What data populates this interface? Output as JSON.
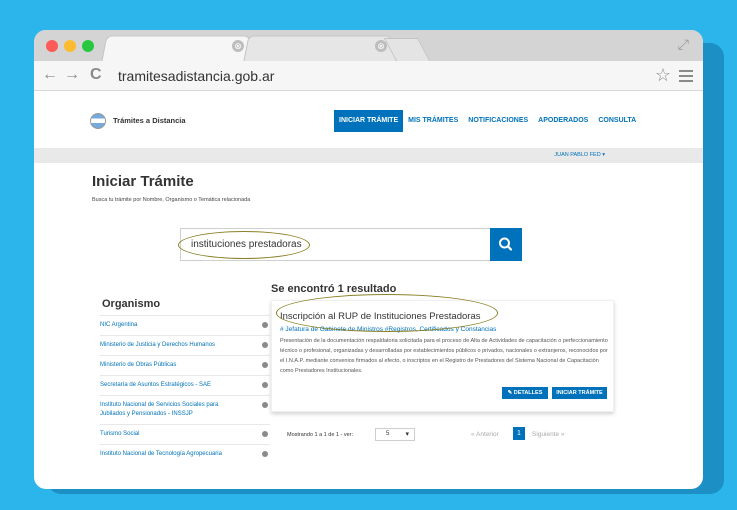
{
  "browser": {
    "url": "tramitesadistancia.gob.ar",
    "tab_close": "⊗",
    "back": "←",
    "forward": "→",
    "reload": "C",
    "star": "☆",
    "expand": "⤢"
  },
  "site": {
    "logo_text": "Trámites a Distancia",
    "nav": [
      {
        "label": "INICIAR TRÁMITE"
      },
      {
        "label": "MIS TRÁMITES"
      },
      {
        "label": "NOTIFICACIONES"
      },
      {
        "label": "APODERADOS"
      },
      {
        "label": "CONSULTA"
      }
    ],
    "user_label": "JUAN PABLO FED ▾"
  },
  "page": {
    "title": "Iniciar Trámite",
    "subtitle": "Busca tu trámite por Nombre, Organismo o Temática relacionada",
    "search_value": "instituciones prestadoras"
  },
  "sidebar": {
    "title": "Organismo",
    "items": [
      {
        "label": "NIC Argentina"
      },
      {
        "label": "Ministerio de Justicia y Derechos Humanos"
      },
      {
        "label": "Ministerio de Obras Públicas"
      },
      {
        "label": "Secretaría de Asuntos Estratégicos - SAE"
      },
      {
        "label": "Instituto Nacional de Servicios Sociales para Jubilados y Pensionados - INSSJP"
      },
      {
        "label": "Turismo Social"
      },
      {
        "label": "Instituto Nacional de Tecnología Agropecuaria"
      }
    ]
  },
  "results": {
    "count_text": "Se encontró 1 resultado",
    "card": {
      "title": "Inscripción al RUP de Instituciones Prestadoras",
      "tags": "# Jefatura de Gabinete de Ministros #Registros, Certificados y Constancias",
      "description": "Presentación de la documentación respaldatoria solicitada para el proceso de Alta de Actividades de capacitación o perfeccionamiento técnico o profesional, organizadas y desarrolladas por establecimientos públicos o privados, nacionales o extranjeros, reconocidos por el I.N.A.P. mediante convenios firmados al efecto, o inscriptos en el Registro de Prestadores del Sistema Nacional de Capacitación como Prestadores Institucionales.",
      "details_label": "✎ DETALLES",
      "start_label": "INICIAR TRÁMITE"
    }
  },
  "pager": {
    "showing": "Mostrando 1 a 1 de 1 - ver:",
    "per_page": "5",
    "prev": "« Anterior",
    "current": "1",
    "next": "Siguiente »"
  }
}
